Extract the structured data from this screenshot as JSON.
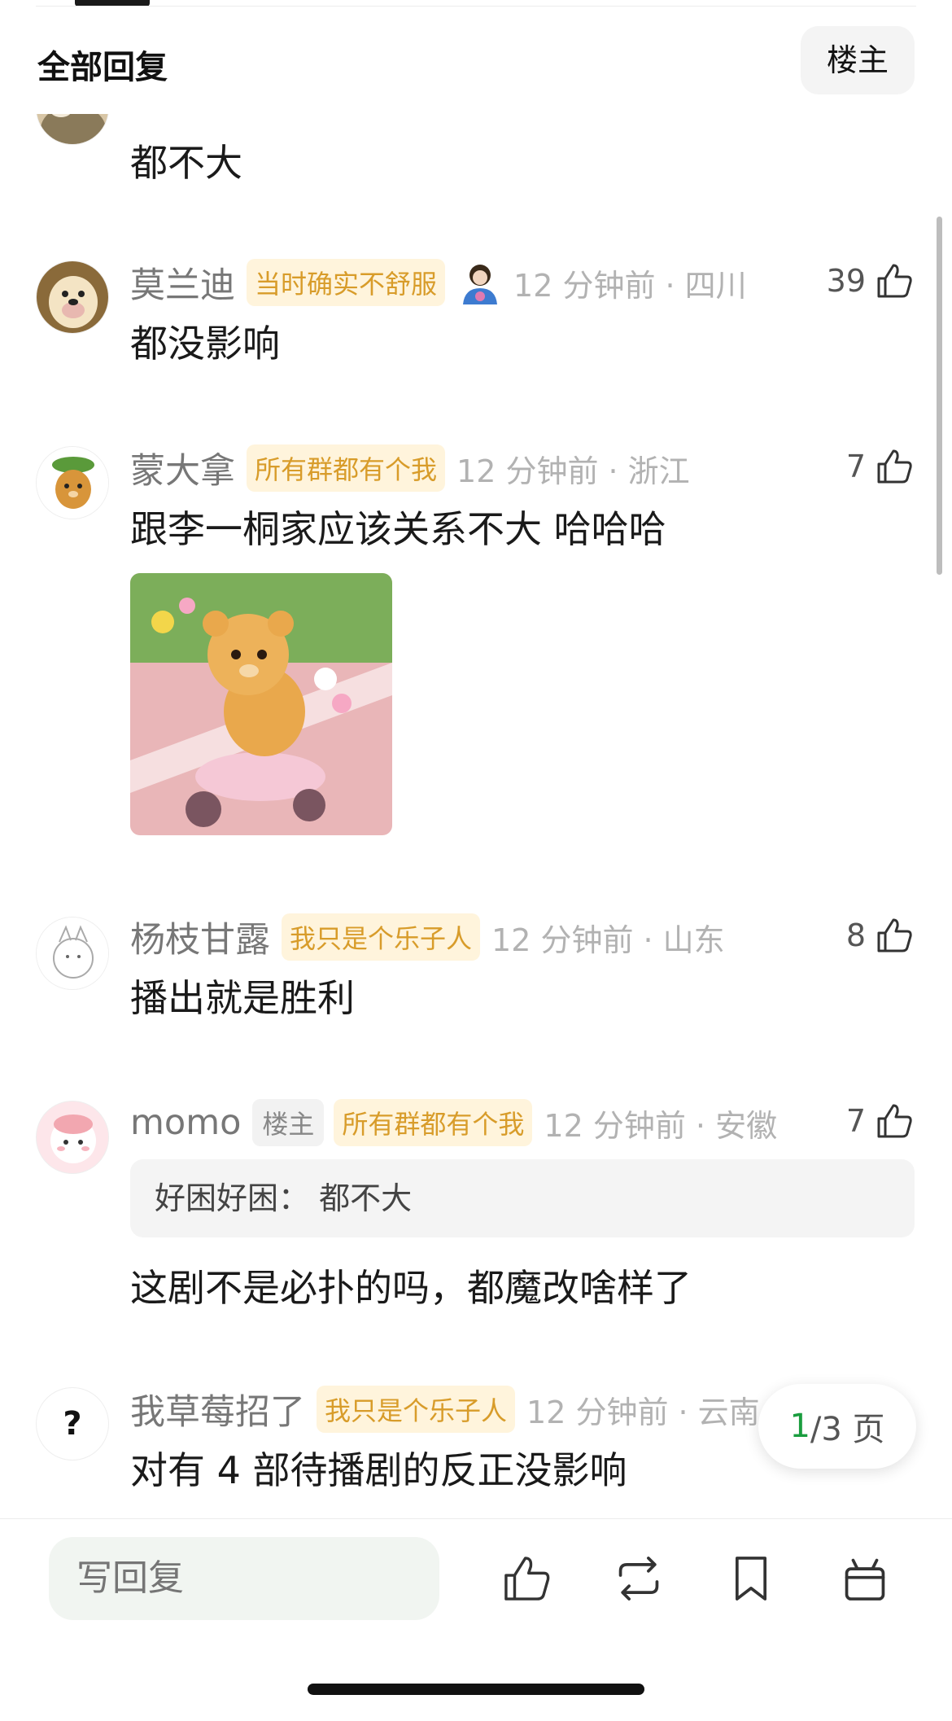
{
  "header": {
    "title": "全部回复",
    "owner_filter": "楼主"
  },
  "top_partial": {
    "text": "都不大"
  },
  "comments": [
    {
      "name": "莫兰迪",
      "badge": "当时确实不舒服",
      "time": "12 分钟前 · 四川",
      "likes": "39",
      "text": "都没影响"
    },
    {
      "name": "蒙大拿",
      "badge": "所有群都有个我",
      "time": "12 分钟前 · 浙江",
      "likes": "7",
      "text": "跟李一桐家应该关系不大 哈哈哈"
    },
    {
      "name": "杨枝甘露",
      "badge": "我只是个乐子人",
      "time": "12 分钟前 · 山东",
      "likes": "8",
      "text": "播出就是胜利"
    },
    {
      "name": "momo",
      "owner_badge": "楼主",
      "badge": "所有群都有个我",
      "time": "12 分钟前 · 安徽",
      "likes": "7",
      "quote": "好困好困：  都不大",
      "text": "这剧不是必扑的吗，都魔改啥样了"
    },
    {
      "name": "我草莓招了",
      "badge": "我只是个乐子人",
      "time": "12 分钟前 · 云南",
      "text": "对有 4 部待播剧的反正没影响",
      "avatar_glyph": "?"
    }
  ],
  "pager": {
    "current": "1",
    "total_suffix": "/3 页"
  },
  "bottom_bar": {
    "reply_placeholder": "写回复"
  },
  "colors": {
    "badge_text": "#d89c2a",
    "badge_bg": "#fff4dc",
    "pager_current": "#1a9d3f"
  }
}
